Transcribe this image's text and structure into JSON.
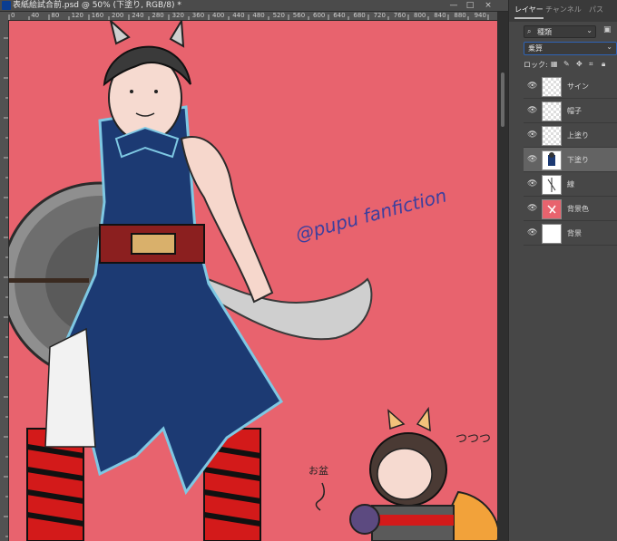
{
  "window": {
    "title": "表紙絵試合前.psd @ 50% (下塗り, RGB/8) *",
    "controls": [
      "—",
      "□",
      "×"
    ]
  },
  "ruler": {
    "top_labels": [
      "0",
      "10",
      "40",
      "60",
      "80",
      "100",
      "120",
      "140",
      "160",
      "180",
      "200",
      "220",
      "240",
      "260",
      "280",
      "300",
      "320",
      "340",
      "360",
      "380",
      "400",
      "420",
      "440",
      "460",
      "480",
      "500",
      "520",
      "540",
      "560",
      "580",
      "600",
      "620",
      "640",
      "660",
      "680",
      "700",
      "720",
      "740",
      "760",
      "780",
      "800",
      "820",
      "840",
      "860",
      "880",
      "900",
      "940",
      "960"
    ]
  },
  "canvas": {
    "background": "#e8636e",
    "watermark": "@pupu fanfiction",
    "note_label": "お盆"
  },
  "panel": {
    "tabs": [
      "レイヤー",
      "チャンネル",
      "パス"
    ],
    "active_tab": "レイヤー",
    "filter_label": "種類",
    "blend_mode": "乗算",
    "lock_label": "ロック:",
    "layers": [
      {
        "name": "サイン",
        "thumb": "checker"
      },
      {
        "name": "帽子",
        "thumb": "checker"
      },
      {
        "name": "上塗り",
        "thumb": "checker"
      },
      {
        "name": "下塗り",
        "thumb": "figure",
        "selected": true
      },
      {
        "name": "線",
        "thumb": "figure"
      },
      {
        "name": "背景色",
        "thumb": "red"
      },
      {
        "name": "背景",
        "thumb": "white"
      }
    ]
  }
}
